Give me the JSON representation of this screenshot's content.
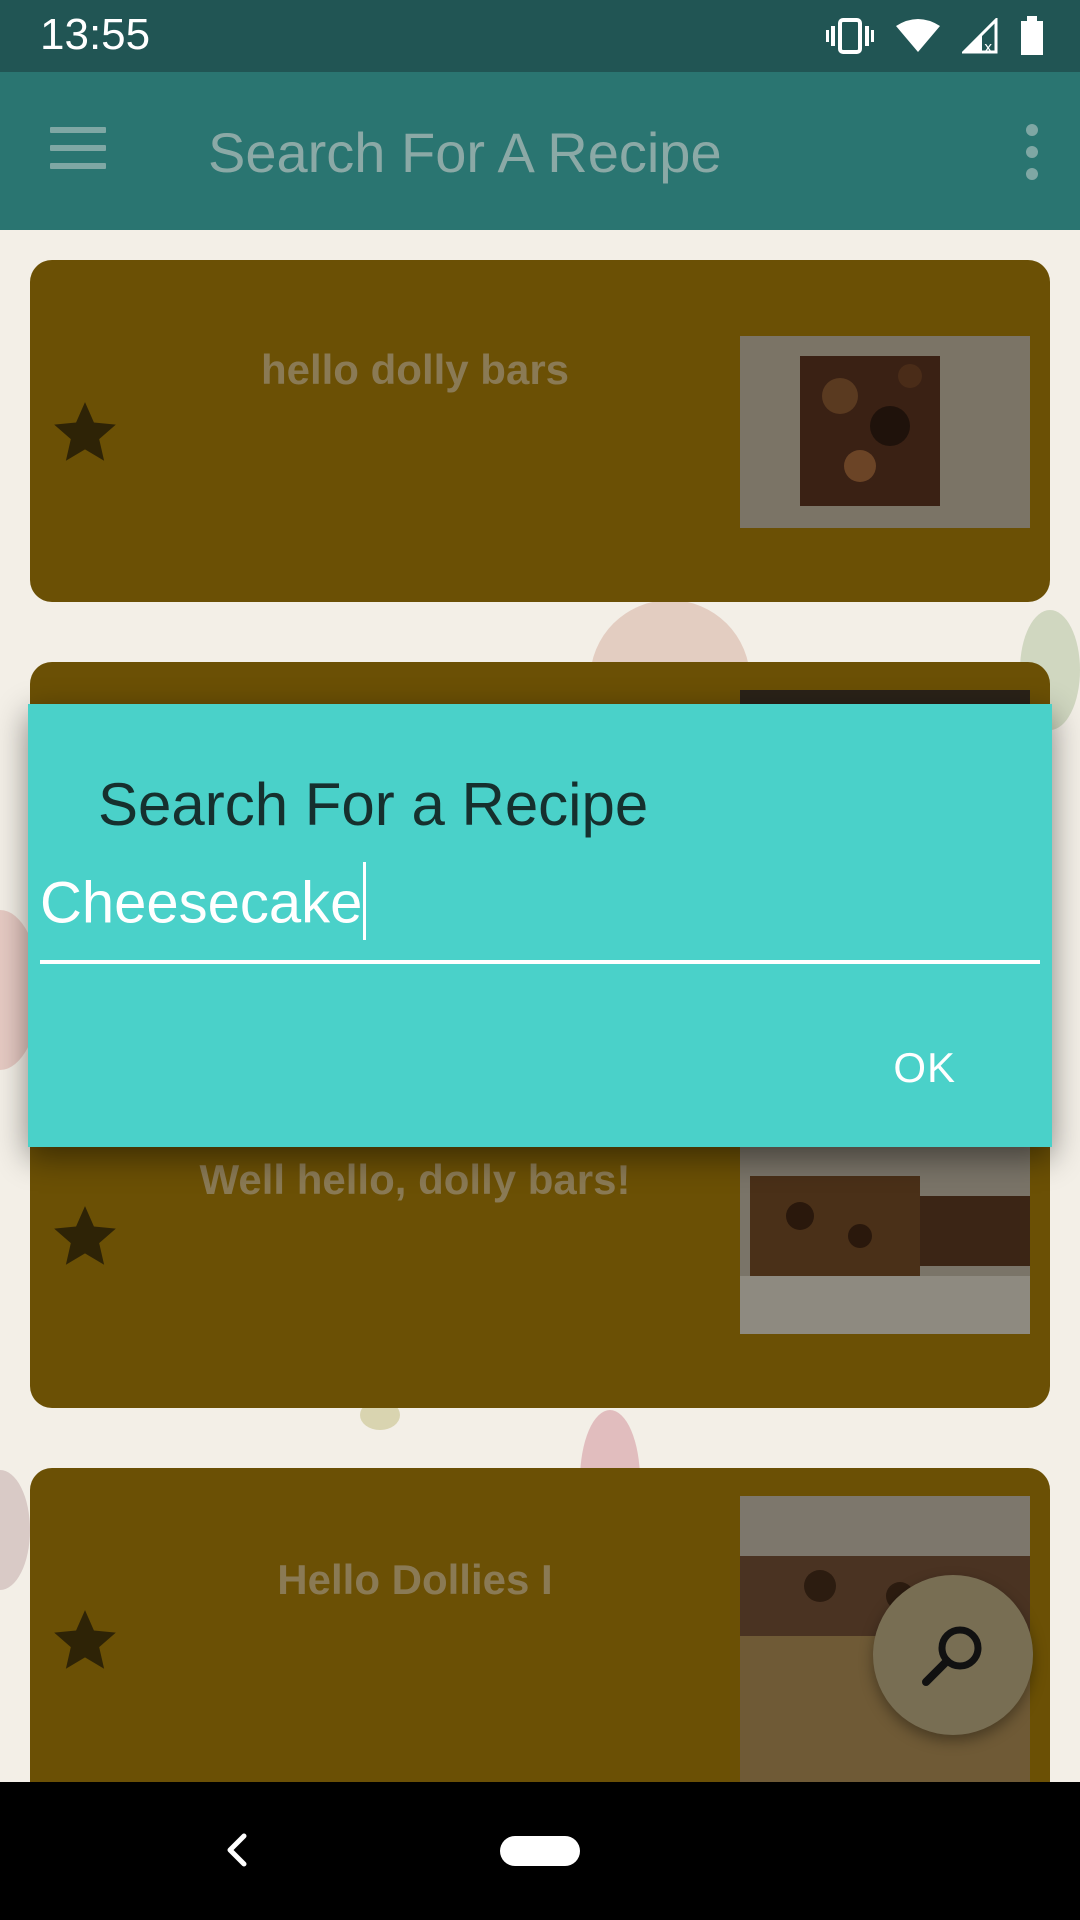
{
  "status_bar": {
    "time": "13:55"
  },
  "app_bar": {
    "title": "Search For A Recipe"
  },
  "cards": [
    {
      "title": "hello dolly bars"
    },
    {
      "title": ""
    },
    {
      "title": "Well hello, dolly bars!"
    },
    {
      "title": "Hello Dollies I"
    }
  ],
  "dialog": {
    "title": "Search For a Recipe",
    "input_value": "Cheesecake",
    "ok_label": "OK"
  },
  "colors": {
    "status_bar": "#215554",
    "app_bar": "#2a7571",
    "card": "#6b5005",
    "dialog": "#4ad1c9"
  }
}
